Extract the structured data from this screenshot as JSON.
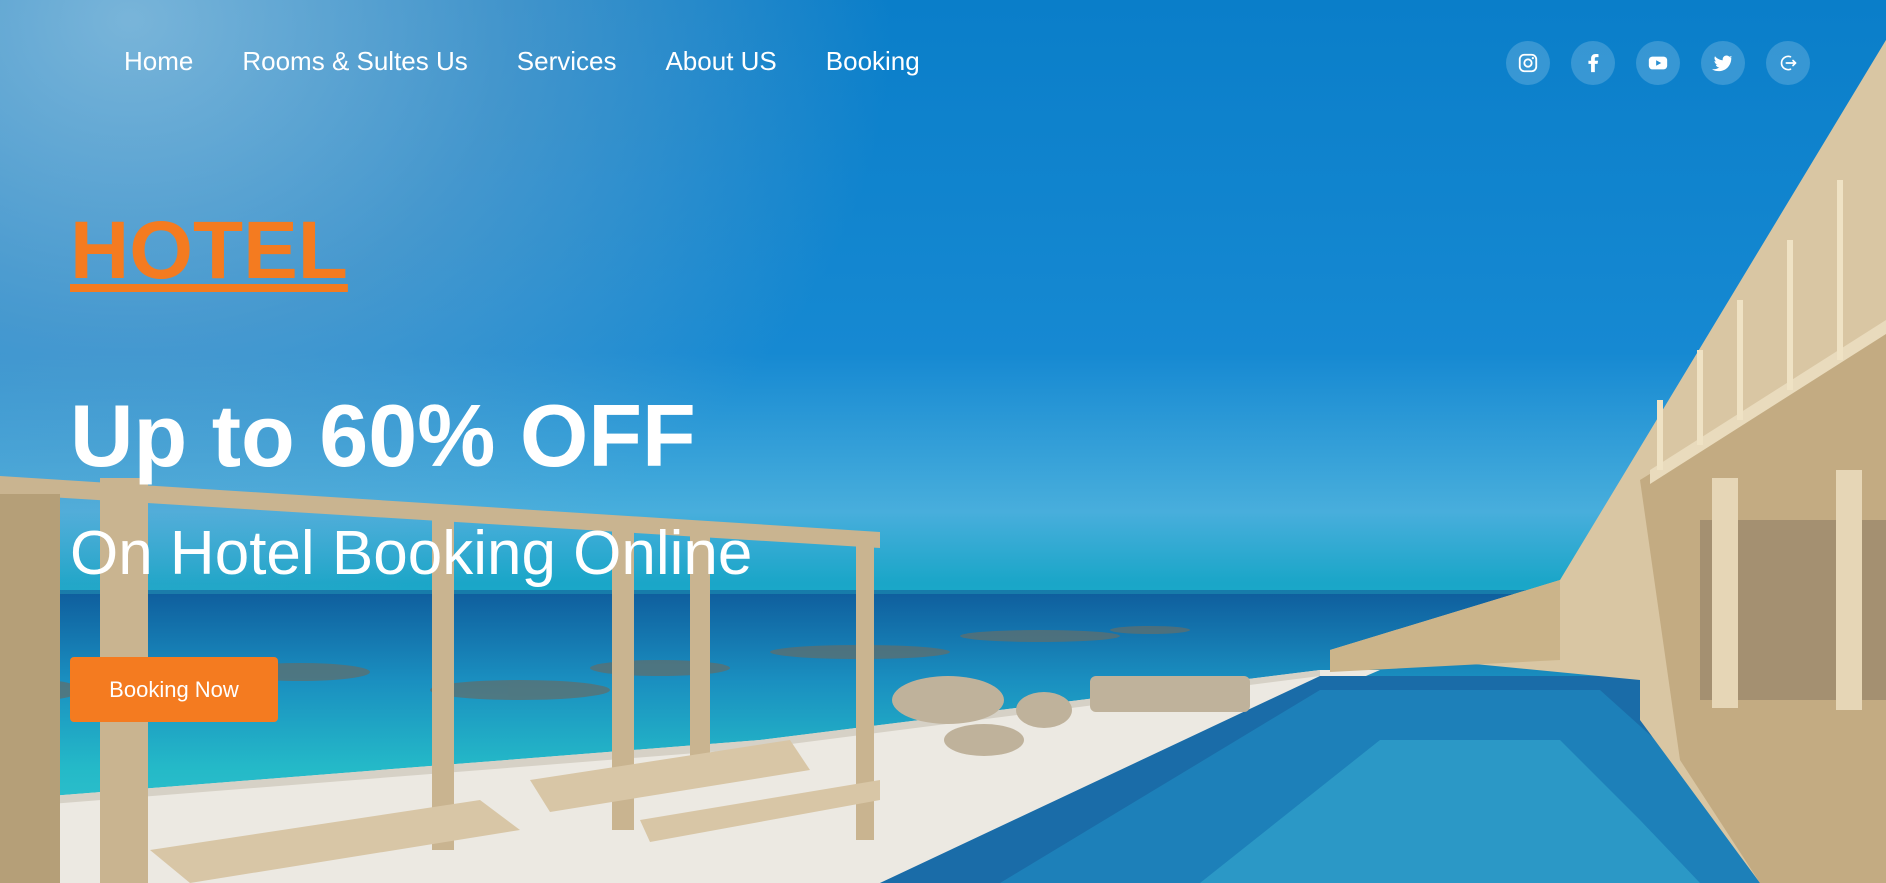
{
  "nav": {
    "items": [
      {
        "label": "Home"
      },
      {
        "label": "Rooms & Sultes Us"
      },
      {
        "label": "Services"
      },
      {
        "label": "About US"
      },
      {
        "label": "Booking"
      }
    ]
  },
  "socials": [
    "instagram-icon",
    "facebook-icon",
    "youtube-icon",
    "twitter-icon",
    "logout-icon"
  ],
  "hero": {
    "brand": "HOTEL",
    "headline": "Up to 60% OFF",
    "subline": "On Hotel Booking Online",
    "cta_label": "Booking Now"
  },
  "colors": {
    "accent": "#f47b20",
    "text": "#ffffff",
    "sky": "#0a7ec9",
    "sea": "#24b9c8"
  }
}
